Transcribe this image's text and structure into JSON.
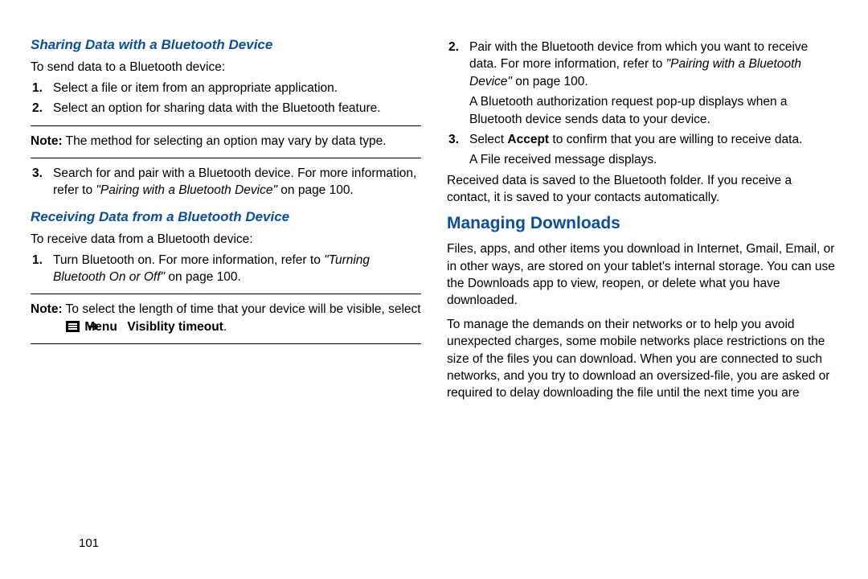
{
  "page_number": "101",
  "left": {
    "sharing": {
      "heading": "Sharing Data with a Bluetooth Device",
      "intro": "To send data to a Bluetooth device:",
      "steps": {
        "s1": "Select a file or item from an appropriate application.",
        "s2": "Select an option for sharing data with the Bluetooth feature.",
        "s3_a": "Search for and pair with a Bluetooth device. For more information, refer to ",
        "s3_ref": "\"Pairing with a Bluetooth Device\"",
        "s3_b": " on page 100."
      },
      "note": "The method for selecting an option may vary by data type."
    },
    "receiving": {
      "heading": "Receiving Data from a Bluetooth Device",
      "intro": "To receive data from a Bluetooth device:",
      "steps": {
        "s1_a": "Turn Bluetooth on. For more information, refer to ",
        "s1_ref": "\"Turning Bluetooth On or Off\"",
        "s1_b": " on page 100."
      },
      "note_a": "To select the length of time that your device will be visible, select ",
      "note_menu": "Menu",
      "note_arrow": "➔",
      "note_vis": "Visiblity timeout",
      "note_end": "."
    }
  },
  "right": {
    "step2_a": "Pair with the Bluetooth device from which you want to receive data. For more information, refer to ",
    "step2_ref": "\"Pairing with a Bluetooth Device\"",
    "step2_b": " on page 100.",
    "step2_sub": "A Bluetooth authorization request pop-up displays when a Bluetooth device sends data to your device.",
    "step3_a": "Select ",
    "step3_accept": "Accept",
    "step3_b": " to confirm that you are willing to receive data.",
    "step3_sub": "A File received message displays.",
    "received_para": "Received data is saved to the Bluetooth folder. If you receive a contact, it is saved to your contacts automatically.",
    "managing_heading": "Managing Downloads",
    "managing_p1": "Files, apps, and other items you download in Internet, Gmail, Email, or in other ways, are stored on your tablet's internal storage. You can use the Downloads app to view, reopen, or delete what you have downloaded.",
    "managing_p2": "To manage the demands on their networks or to help you avoid unexpected charges, some mobile networks place restrictions on the size of the files you can download. When you are connected to such networks, and you try to download an oversized-file, you are asked or required to delay downloading the file until the next time you are"
  },
  "labels": {
    "note": "Note:",
    "n1": "1.",
    "n2": "2.",
    "n3": "3."
  }
}
